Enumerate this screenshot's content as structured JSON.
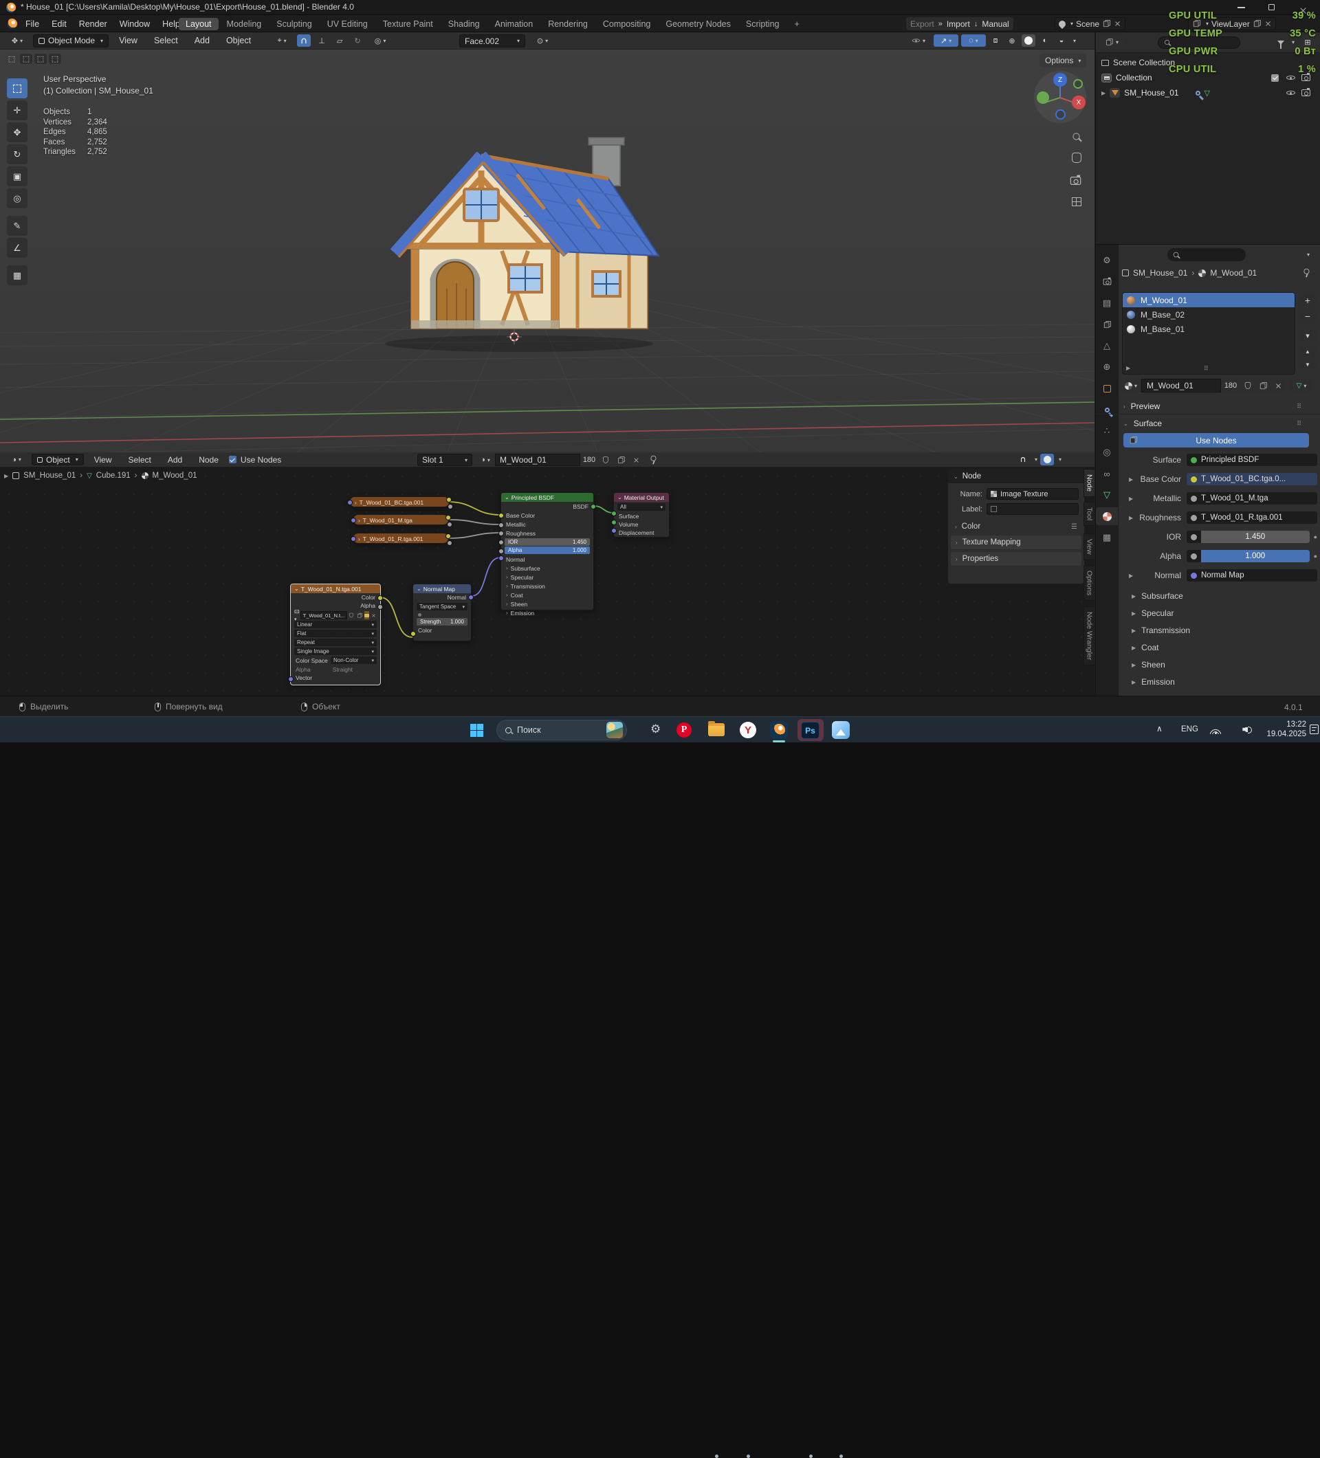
{
  "window": {
    "title": "* House_01 [C:\\Users\\Kamila\\Desktop\\My\\House_01\\Export\\House_01.blend] - Blender 4.0"
  },
  "gpu_overlay": {
    "lines": [
      {
        "label": "GPU UTIL",
        "value": "39 %"
      },
      {
        "label": "GPU TEMP",
        "value": "35 °C"
      },
      {
        "label": "GPU PWR",
        "value": "0 Вт"
      },
      {
        "label": "CPU UTIL",
        "value": "1 %"
      }
    ]
  },
  "topbar": {
    "menus": [
      "File",
      "Edit",
      "Render",
      "Window",
      "Help"
    ],
    "workspaces": [
      "Layout",
      "Modeling",
      "Sculpting",
      "UV Editing",
      "Texture Paint",
      "Shading",
      "Animation",
      "Rendering",
      "Compositing",
      "Geometry Nodes",
      "Scripting"
    ],
    "add_tab": "+",
    "export_label": "Export",
    "import_label": "Import",
    "manual_label": "Manual",
    "scene": "Scene",
    "view_layer": "ViewLayer"
  },
  "viewport": {
    "header": {
      "mode": "Object Mode",
      "menus": [
        "View",
        "Select",
        "Add",
        "Object"
      ],
      "orientation": "Face.002",
      "options": "Options"
    },
    "overlay": {
      "perspective": "User Perspective",
      "context": "(1) Collection | SM_House_01"
    },
    "stats": {
      "rows": [
        [
          "Objects",
          "1"
        ],
        [
          "Vertices",
          "2,364"
        ],
        [
          "Edges",
          "4,865"
        ],
        [
          "Faces",
          "2,752"
        ],
        [
          "Triangles",
          "2,752"
        ]
      ]
    },
    "gizmo": {
      "x": "X",
      "z": "Z"
    }
  },
  "outliner": {
    "items": [
      {
        "label": "Scene Collection"
      },
      {
        "label": "Collection"
      },
      {
        "label": "SM_House_01"
      }
    ]
  },
  "properties": {
    "breadcrumb": {
      "object": "SM_House_01",
      "material": "M_Wood_01"
    },
    "slots": [
      "M_Wood_01",
      "M_Base_02",
      "M_Base_01"
    ],
    "datablock": {
      "name": "M_Wood_01",
      "users": "180"
    },
    "preview_label": "Preview",
    "surface_label": "Surface",
    "use_nodes": "Use Nodes",
    "rows": [
      {
        "label": "Surface",
        "value": "Principled BSDF"
      },
      {
        "label": "Base Color",
        "value": "T_Wood_01_BC.tga.0..."
      },
      {
        "label": "Metallic",
        "value": "T_Wood_01_M.tga"
      },
      {
        "label": "Roughness",
        "value": "T_Wood_01_R.tga.001"
      },
      {
        "label": "IOR",
        "value": "1.450"
      },
      {
        "label": "Alpha",
        "value": "1.000"
      },
      {
        "label": "Normal",
        "value": "Normal Map"
      }
    ],
    "collapsed": [
      "Subsurface",
      "Specular",
      "Transmission",
      "Coat",
      "Sheen",
      "Emission"
    ]
  },
  "shader": {
    "header": {
      "mode": "Object",
      "menus": [
        "View",
        "Select",
        "Add",
        "Node"
      ],
      "use_nodes": "Use Nodes",
      "slot": "Slot 1",
      "material": "M_Wood_01",
      "users": "180"
    },
    "breadcrumb": [
      "SM_House_01",
      "Cube.191",
      "M_Wood_01"
    ],
    "nodes": {
      "tex_bc": "T_Wood_01_BC.tga.001",
      "tex_m": "T_Wood_01_M.tga",
      "tex_r": "T_Wood_01_R.tga.001",
      "principled": {
        "title": "Principled BSDF",
        "output": "BSDF",
        "inputs": [
          "Base Color",
          "Metallic",
          "Roughness"
        ],
        "ior_label": "IOR",
        "ior": "1.450",
        "alpha_label": "Alpha",
        "alpha": "1.000",
        "normal": "Normal",
        "collapsed": [
          "Subsurface",
          "Specular",
          "Transmission",
          "Coat",
          "Sheen",
          "Emission"
        ]
      },
      "material_output": {
        "title": "Material Output",
        "target": "All",
        "inputs": [
          "Surface",
          "Volume",
          "Displacement"
        ]
      },
      "tex_n": {
        "title": "T_Wood_01_N.tga.001",
        "outputs": [
          "Color",
          "Alpha"
        ],
        "image": "T_Wood_01_N.t...",
        "interpolation": "Linear",
        "projection": "Flat",
        "extension": "Repeat",
        "source": "Single Image",
        "colorspace_label": "Color Space",
        "colorspace": "Non-Color",
        "alpha_label": "Alpha",
        "alpha_mode": "Straight",
        "input": "Vector"
      },
      "normal_map": {
        "title": "Normal Map",
        "output": "Normal",
        "space": "Tangent Space",
        "strength_label": "Strength",
        "strength": "1.000",
        "input": "Color"
      }
    },
    "n_panel": {
      "title": "Node",
      "name_label": "Name:",
      "name_value": "Image Texture",
      "label_label": "Label:",
      "color_section": "Color",
      "texture_mapping": "Texture Mapping",
      "properties": "Properties"
    },
    "side_tabs": [
      "Node",
      "Tool",
      "View",
      "Options",
      "Node Wrangler"
    ]
  },
  "statusbar": {
    "hints": [
      "Выделить",
      "Повернуть вид",
      "Объект"
    ],
    "version": "4.0.1"
  },
  "taskbar": {
    "search_placeholder": "Поиск",
    "tray": {
      "lang": "ENG",
      "time": "13:22",
      "date": "19.04.2025"
    }
  },
  "colors": {
    "accent": "#4772b3",
    "bsdf_header": "#2d6b30",
    "output_header": "#5a2f45",
    "texture_header": "#79461d",
    "vector_header": "#3e4c6e",
    "gpu_green": "#8CC63E"
  }
}
